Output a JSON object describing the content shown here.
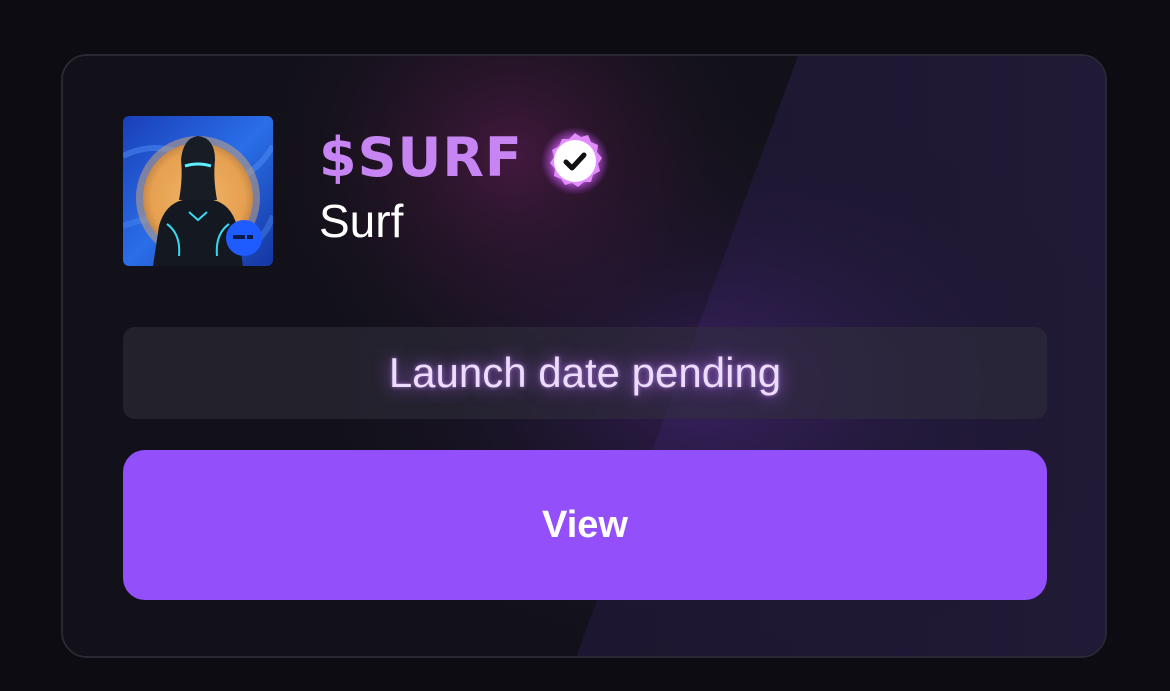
{
  "token": {
    "ticker": "$SURF",
    "name": "Surf",
    "verified": true,
    "avatar_icon": "armored-figure-avatar",
    "badge_icon": "chain-badge-icon"
  },
  "status": {
    "text": "Launch date pending"
  },
  "actions": {
    "view_label": "View"
  },
  "colors": {
    "page_bg": "#0d0c12",
    "card_bg": "#121119",
    "ticker": "#c685f3",
    "button": "#9350fa",
    "status_glow": "#ba6eff",
    "badge_blue": "#1e5cff"
  }
}
